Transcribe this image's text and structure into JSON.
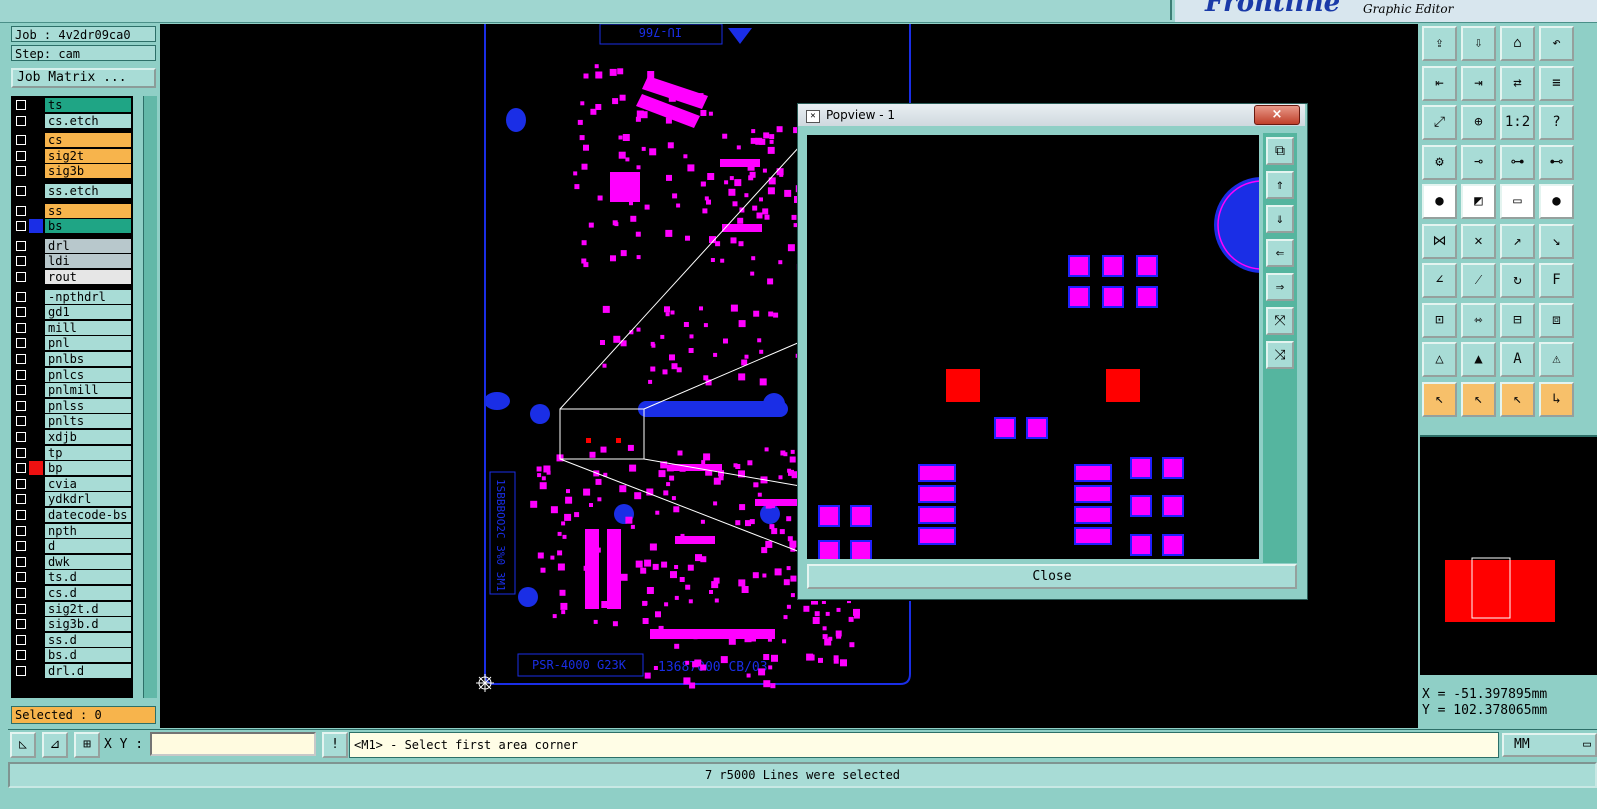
{
  "app": {
    "brand": "Frontline",
    "subtitle": "Graphic Editor"
  },
  "job_info": {
    "job": "Job : 4v2dr09ca0",
    "step": "Step: cam",
    "matrix_button": "Job Matrix ..."
  },
  "layers": [
    {
      "name": "ts",
      "color": "#1fa585",
      "swatch": "#000000"
    },
    {
      "name": "cs.etch",
      "color": "#a8dcd6",
      "swatch": "#000000"
    },
    {
      "name": "cs",
      "color": "#f7b44c",
      "swatch": "#000000"
    },
    {
      "name": "sig2t",
      "color": "#f7b44c",
      "swatch": "#000000"
    },
    {
      "name": "sig3b",
      "color": "#f7b44c",
      "swatch": "#000000"
    },
    {
      "name": "ss.etch",
      "color": "#a8dcd6",
      "swatch": "#000000"
    },
    {
      "name": "ss",
      "color": "#f7b44c",
      "swatch": "#000000"
    },
    {
      "name": "bs",
      "color": "#1fa585",
      "swatch": "#1a2ee6"
    },
    {
      "name": "drl",
      "color": "#b8c8cc",
      "swatch": "#000000"
    },
    {
      "name": "ldi",
      "color": "#b8c8cc",
      "swatch": "#000000"
    },
    {
      "name": "rout",
      "color": "#e6e6e6",
      "swatch": "#000000"
    },
    {
      "name": "-npthdrl",
      "color": "#a8dcd6",
      "swatch": "#000000"
    },
    {
      "name": "gd1",
      "color": "#a8dcd6",
      "swatch": "#000000"
    },
    {
      "name": "mill",
      "color": "#a8dcd6",
      "swatch": "#000000"
    },
    {
      "name": "pnl",
      "color": "#a8dcd6",
      "swatch": "#000000"
    },
    {
      "name": "pnlbs",
      "color": "#a8dcd6",
      "swatch": "#000000"
    },
    {
      "name": "pnlcs",
      "color": "#a8dcd6",
      "swatch": "#000000"
    },
    {
      "name": "pnlmill",
      "color": "#a8dcd6",
      "swatch": "#000000"
    },
    {
      "name": "pnlss",
      "color": "#a8dcd6",
      "swatch": "#000000"
    },
    {
      "name": "pnlts",
      "color": "#a8dcd6",
      "swatch": "#000000"
    },
    {
      "name": "xdjb",
      "color": "#a8dcd6",
      "swatch": "#000000"
    },
    {
      "name": "tp",
      "color": "#a8dcd6",
      "swatch": "#000000"
    },
    {
      "name": "bp",
      "color": "#a8dcd6",
      "swatch": "#ee1111"
    },
    {
      "name": "cvia",
      "color": "#a8dcd6",
      "swatch": "#000000"
    },
    {
      "name": "ydkdrl",
      "color": "#a8dcd6",
      "swatch": "#000000"
    },
    {
      "name": "datecode-bs",
      "color": "#a8dcd6",
      "swatch": "#000000"
    },
    {
      "name": "npth",
      "color": "#a8dcd6",
      "swatch": "#000000"
    },
    {
      "name": "d",
      "color": "#a8dcd6",
      "swatch": "#000000"
    },
    {
      "name": "dwk",
      "color": "#a8dcd6",
      "swatch": "#000000"
    },
    {
      "name": "ts.d",
      "color": "#a8dcd6",
      "swatch": "#000000"
    },
    {
      "name": "cs.d",
      "color": "#a8dcd6",
      "swatch": "#000000"
    },
    {
      "name": "sig2t.d",
      "color": "#a8dcd6",
      "swatch": "#000000"
    },
    {
      "name": "sig3b.d",
      "color": "#a8dcd6",
      "swatch": "#000000"
    },
    {
      "name": "ss.d",
      "color": "#a8dcd6",
      "swatch": "#000000"
    },
    {
      "name": "bs.d",
      "color": "#a8dcd6",
      "swatch": "#000000"
    },
    {
      "name": "drl.d",
      "color": "#a8dcd6",
      "swatch": "#000000"
    }
  ],
  "selected_count": "Selected : 0",
  "board": {
    "top_label": "IU-766",
    "bottom_label_left": "PSR-4000 G23K",
    "bottom_label_right": "13687000 CB/03",
    "side_label": "1SBBBOO2C 3%0 3M1"
  },
  "popview": {
    "title": "Popview - 1",
    "close_label": "Close",
    "window_close": "×"
  },
  "command": {
    "xy_label": "X Y :",
    "xy_value": "",
    "prompt": "<M1> - Select first area corner",
    "units": "MM"
  },
  "coords": {
    "x": "X = -51.397895mm",
    "y": "Y = 102.378065mm"
  },
  "status": "7 r5000 Lines were selected",
  "colors": {
    "pad": "#ff00ff",
    "pad_border": "#2020ff",
    "selected": "#ff0000",
    "board_outline": "#1a2ee6"
  }
}
